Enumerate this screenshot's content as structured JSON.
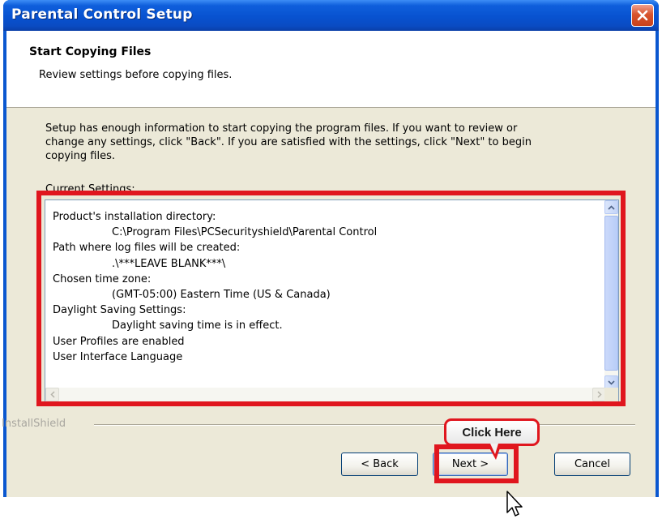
{
  "window": {
    "title": "Parental Control Setup"
  },
  "header": {
    "title": "Start Copying Files",
    "subtitle": "Review settings before copying files."
  },
  "body": {
    "intro_lines": [
      "Setup has enough information to start copying the program files.  If you want to review or",
      "change any settings, click \"Back\".  If you are satisfied with the settings, click \"Next\" to begin",
      "copying files."
    ],
    "current_settings_label": "Current Settings:"
  },
  "settings": {
    "lines": [
      {
        "text": "Product's installation directory:",
        "indent": false
      },
      {
        "text": "C:\\Program Files\\PCSecurityshield\\Parental Control",
        "indent": true
      },
      {
        "text": "Path where log files will be created:",
        "indent": false
      },
      {
        "text": ".\\***LEAVE BLANK***\\",
        "indent": true
      },
      {
        "text": "Chosen time zone:",
        "indent": false
      },
      {
        "text": "(GMT-05:00) Eastern Time (US & Canada)",
        "indent": true
      },
      {
        "text": "Daylight Saving Settings:",
        "indent": false
      },
      {
        "text": "Daylight saving time is in effect.",
        "indent": true
      },
      {
        "text": "User Profiles are enabled",
        "indent": false
      },
      {
        "text": "User Interface Language",
        "indent": false
      }
    ]
  },
  "footer": {
    "brand": "InstallShield",
    "back_label": "< Back",
    "next_label": "Next >",
    "cancel_label": "Cancel"
  },
  "annotation": {
    "callout_text": "Click Here",
    "highlight_color": "#e0161e"
  }
}
